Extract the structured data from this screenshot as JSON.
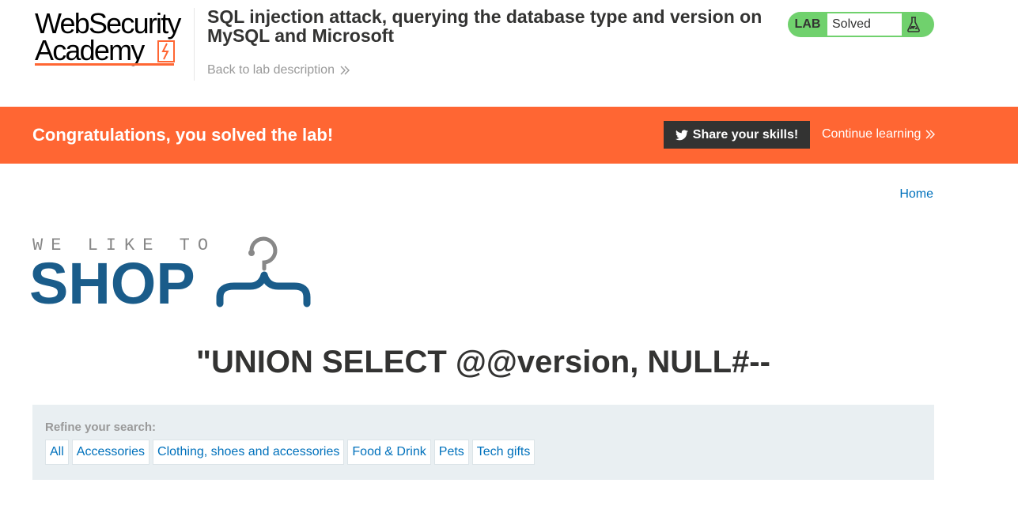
{
  "academy": {
    "logo_line1": "WebSecurity",
    "logo_line2": "Academy",
    "lab_title": "SQL injection attack, querying the database type and version on MySQL and Microsoft",
    "back_link": "Back to lab description",
    "lab_badge": "LAB",
    "lab_status": "Solved",
    "icons": {
      "back": "chevron-double-right-icon",
      "status": "flask-icon"
    }
  },
  "banner": {
    "message": "Congratulations, you solved the lab!",
    "share_label": "Share your skills!",
    "continue_label": "Continue learning",
    "background": "#ff6633",
    "icons": {
      "share": "twitter-icon",
      "continue": "chevron-double-right-icon"
    }
  },
  "nav": {
    "home_label": "Home"
  },
  "shop_logo": {
    "tagline": "WE LIKE TO",
    "word": "SHOP",
    "icon": "hanger-icon"
  },
  "search": {
    "heading": "\"UNION SELECT @@version, NULL#--"
  },
  "filters": {
    "label": "Refine your search:",
    "items": [
      {
        "label": "All"
      },
      {
        "label": "Accessories"
      },
      {
        "label": "Clothing, shoes and accessories"
      },
      {
        "label": "Food & Drink"
      },
      {
        "label": "Pets"
      },
      {
        "label": "Tech gifts"
      }
    ]
  },
  "colors": {
    "accent": "#ff6633",
    "link": "#0071bc",
    "solved": "#70d16d",
    "shop_blue": "#1a5c8a"
  }
}
